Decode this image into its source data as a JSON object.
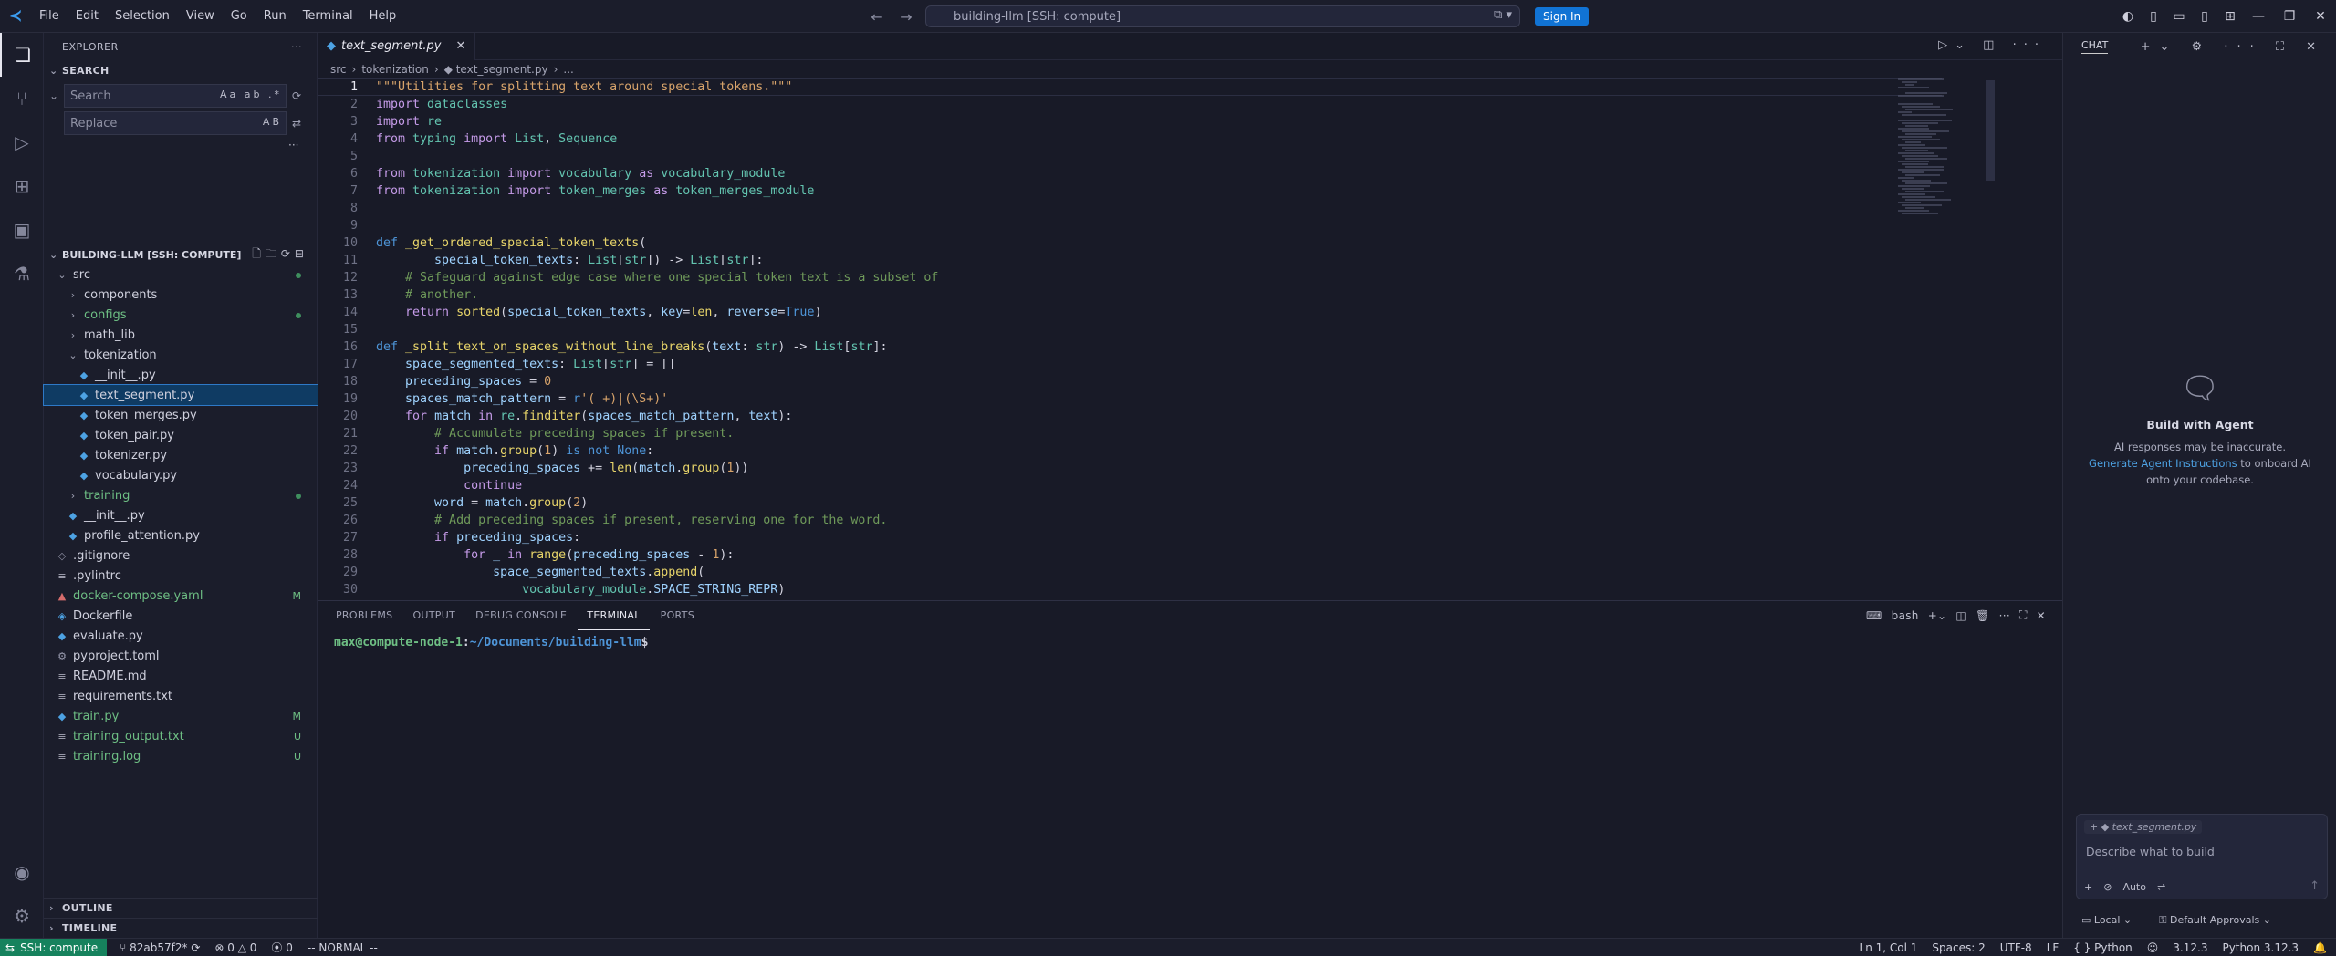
{
  "menu": [
    "File",
    "Edit",
    "Selection",
    "View",
    "Go",
    "Run",
    "Terminal",
    "Help"
  ],
  "command_center": {
    "text": "building-llm [SSH: compute]",
    "signin": "Sign In"
  },
  "sidebar": {
    "title": "EXPLORER",
    "search_section": "SEARCH",
    "search_placeholder": "Search",
    "search_opts": "Aa ab .*",
    "replace_placeholder": "Replace",
    "replace_opts": "AB",
    "workspace": "BUILDING-LLM [SSH: COMPUTE]",
    "tree": [
      {
        "name": "src",
        "type": "folder-open",
        "indent": 0,
        "dot": true
      },
      {
        "name": "components",
        "type": "folder",
        "indent": 1
      },
      {
        "name": "configs",
        "type": "folder",
        "indent": 1,
        "dot": true,
        "green": true
      },
      {
        "name": "math_lib",
        "type": "folder",
        "indent": 1
      },
      {
        "name": "tokenization",
        "type": "folder-open",
        "indent": 1
      },
      {
        "name": "__init__.py",
        "type": "py",
        "indent": 2
      },
      {
        "name": "text_segment.py",
        "type": "py",
        "indent": 2,
        "selected": true
      },
      {
        "name": "token_merges.py",
        "type": "py",
        "indent": 2
      },
      {
        "name": "token_pair.py",
        "type": "py",
        "indent": 2
      },
      {
        "name": "tokenizer.py",
        "type": "py",
        "indent": 2
      },
      {
        "name": "vocabulary.py",
        "type": "py",
        "indent": 2
      },
      {
        "name": "training",
        "type": "folder",
        "indent": 1,
        "dot": true,
        "green": true
      },
      {
        "name": "__init__.py",
        "type": "py",
        "indent": 1
      },
      {
        "name": "profile_attention.py",
        "type": "py",
        "indent": 1
      },
      {
        "name": ".gitignore",
        "type": "git",
        "indent": 0
      },
      {
        "name": ".pylintrc",
        "type": "txt",
        "indent": 0
      },
      {
        "name": "docker-compose.yaml",
        "type": "yaml",
        "indent": 0,
        "badge": "M",
        "green": true
      },
      {
        "name": "Dockerfile",
        "type": "docker",
        "indent": 0
      },
      {
        "name": "evaluate.py",
        "type": "py",
        "indent": 0
      },
      {
        "name": "pyproject.toml",
        "type": "toml",
        "indent": 0
      },
      {
        "name": "README.md",
        "type": "txt",
        "indent": 0
      },
      {
        "name": "requirements.txt",
        "type": "txt",
        "indent": 0
      },
      {
        "name": "train.py",
        "type": "py",
        "indent": 0,
        "badge": "M",
        "green": true
      },
      {
        "name": "training_output.txt",
        "type": "txt",
        "indent": 0,
        "badge": "U",
        "green": true
      },
      {
        "name": "training.log",
        "type": "txt",
        "indent": 0,
        "badge": "U",
        "green": true
      }
    ],
    "outline": "OUTLINE",
    "timeline": "TIMELINE"
  },
  "editor": {
    "tab": "text_segment.py",
    "breadcrumb": [
      "src",
      "tokenization",
      "text_segment.py",
      "..."
    ],
    "lines": [
      [
        [
          "s",
          "\"\"\"Utilities for splitting text around special tokens.\"\"\""
        ]
      ],
      [
        [
          "kw",
          "import "
        ],
        [
          "t",
          "dataclasses"
        ]
      ],
      [
        [
          "kw",
          "import "
        ],
        [
          "t",
          "re"
        ]
      ],
      [
        [
          "kw",
          "from "
        ],
        [
          "t",
          "typing "
        ],
        [
          "kw",
          "import "
        ],
        [
          "t",
          "List"
        ],
        [
          "p",
          ", "
        ],
        [
          "t",
          "Sequence"
        ]
      ],
      [],
      [
        [
          "kw",
          "from "
        ],
        [
          "t",
          "tokenization "
        ],
        [
          "kw",
          "import "
        ],
        [
          "t",
          "vocabulary "
        ],
        [
          "kw",
          "as "
        ],
        [
          "t",
          "vocabulary_module"
        ]
      ],
      [
        [
          "kw",
          "from "
        ],
        [
          "t",
          "tokenization "
        ],
        [
          "kw",
          "import "
        ],
        [
          "t",
          "token_merges "
        ],
        [
          "kw",
          "as "
        ],
        [
          "t",
          "token_merges_module"
        ]
      ],
      [],
      [],
      [
        [
          "b",
          "def "
        ],
        [
          "f",
          "_get_ordered_special_token_texts"
        ],
        [
          "p",
          "("
        ]
      ],
      [
        [
          "p",
          "        "
        ],
        [
          "n",
          "special_token_texts"
        ],
        [
          "p",
          ": "
        ],
        [
          "t",
          "List"
        ],
        [
          "p",
          "["
        ],
        [
          "t",
          "str"
        ],
        [
          "p",
          "]) -> "
        ],
        [
          "t",
          "List"
        ],
        [
          "p",
          "["
        ],
        [
          "t",
          "str"
        ],
        [
          "p",
          "]:"
        ]
      ],
      [
        [
          "p",
          "    "
        ],
        [
          "c",
          "# Safeguard against edge case where one special token text is a subset of"
        ]
      ],
      [
        [
          "p",
          "    "
        ],
        [
          "c",
          "# another."
        ]
      ],
      [
        [
          "p",
          "    "
        ],
        [
          "kw",
          "return "
        ],
        [
          "f",
          "sorted"
        ],
        [
          "p",
          "("
        ],
        [
          "n",
          "special_token_texts"
        ],
        [
          "p",
          ", "
        ],
        [
          "n",
          "key"
        ],
        [
          "p",
          "="
        ],
        [
          "f",
          "len"
        ],
        [
          "p",
          ", "
        ],
        [
          "n",
          "reverse"
        ],
        [
          "p",
          "="
        ],
        [
          "b",
          "True"
        ],
        [
          "p",
          ")"
        ]
      ],
      [],
      [
        [
          "b",
          "def "
        ],
        [
          "f",
          "_split_text_on_spaces_without_line_breaks"
        ],
        [
          "p",
          "("
        ],
        [
          "n",
          "text"
        ],
        [
          "p",
          ": "
        ],
        [
          "t",
          "str"
        ],
        [
          "p",
          ") -> "
        ],
        [
          "t",
          "List"
        ],
        [
          "p",
          "["
        ],
        [
          "t",
          "str"
        ],
        [
          "p",
          "]:"
        ]
      ],
      [
        [
          "p",
          "    "
        ],
        [
          "n",
          "space_segmented_texts"
        ],
        [
          "p",
          ": "
        ],
        [
          "t",
          "List"
        ],
        [
          "p",
          "["
        ],
        [
          "t",
          "str"
        ],
        [
          "p",
          "] = []"
        ]
      ],
      [
        [
          "p",
          "    "
        ],
        [
          "n",
          "preceding_spaces"
        ],
        [
          "p",
          " = "
        ],
        [
          "s",
          "0"
        ]
      ],
      [
        [
          "p",
          "    "
        ],
        [
          "n",
          "spaces_match_pattern"
        ],
        [
          "p",
          " = "
        ],
        [
          "b",
          "r"
        ],
        [
          "s",
          "'( +)|(\\S+)'"
        ]
      ],
      [
        [
          "p",
          "    "
        ],
        [
          "kw",
          "for "
        ],
        [
          "n",
          "match "
        ],
        [
          "kw",
          "in "
        ],
        [
          "t",
          "re"
        ],
        [
          "p",
          "."
        ],
        [
          "f",
          "finditer"
        ],
        [
          "p",
          "("
        ],
        [
          "n",
          "spaces_match_pattern"
        ],
        [
          "p",
          ", "
        ],
        [
          "n",
          "text"
        ],
        [
          "p",
          "):"
        ]
      ],
      [
        [
          "p",
          "        "
        ],
        [
          "c",
          "# Accumulate preceding spaces if present."
        ]
      ],
      [
        [
          "p",
          "        "
        ],
        [
          "kw",
          "if "
        ],
        [
          "n",
          "match"
        ],
        [
          "p",
          "."
        ],
        [
          "f",
          "group"
        ],
        [
          "p",
          "("
        ],
        [
          "s",
          "1"
        ],
        [
          "p",
          ") "
        ],
        [
          "b",
          "is not "
        ],
        [
          "b",
          "None"
        ],
        [
          "p",
          ":"
        ]
      ],
      [
        [
          "p",
          "            "
        ],
        [
          "n",
          "preceding_spaces"
        ],
        [
          "p",
          " += "
        ],
        [
          "f",
          "len"
        ],
        [
          "p",
          "("
        ],
        [
          "n",
          "match"
        ],
        [
          "p",
          "."
        ],
        [
          "f",
          "group"
        ],
        [
          "p",
          "("
        ],
        [
          "s",
          "1"
        ],
        [
          "p",
          "))"
        ]
      ],
      [
        [
          "p",
          "            "
        ],
        [
          "kw",
          "continue"
        ]
      ],
      [
        [
          "p",
          "        "
        ],
        [
          "n",
          "word"
        ],
        [
          "p",
          " = "
        ],
        [
          "n",
          "match"
        ],
        [
          "p",
          "."
        ],
        [
          "f",
          "group"
        ],
        [
          "p",
          "("
        ],
        [
          "s",
          "2"
        ],
        [
          "p",
          ")"
        ]
      ],
      [
        [
          "p",
          "        "
        ],
        [
          "c",
          "# Add preceding spaces if present, reserving one for the word."
        ]
      ],
      [
        [
          "p",
          "        "
        ],
        [
          "kw",
          "if "
        ],
        [
          "n",
          "preceding_spaces"
        ],
        [
          "p",
          ":"
        ]
      ],
      [
        [
          "p",
          "            "
        ],
        [
          "kw",
          "for "
        ],
        [
          "n",
          "_ "
        ],
        [
          "kw",
          "in "
        ],
        [
          "f",
          "range"
        ],
        [
          "p",
          "("
        ],
        [
          "n",
          "preceding_spaces"
        ],
        [
          "p",
          " - "
        ],
        [
          "s",
          "1"
        ],
        [
          "p",
          "):"
        ]
      ],
      [
        [
          "p",
          "                "
        ],
        [
          "n",
          "space_segmented_texts"
        ],
        [
          "p",
          "."
        ],
        [
          "f",
          "append"
        ],
        [
          "p",
          "("
        ]
      ],
      [
        [
          "p",
          "                    "
        ],
        [
          "t",
          "vocabulary_module"
        ],
        [
          "p",
          "."
        ],
        [
          "n",
          "SPACE_STRING_REPR"
        ],
        [
          "p",
          ")"
        ]
      ]
    ]
  },
  "panel": {
    "tabs": [
      "PROBLEMS",
      "OUTPUT",
      "DEBUG CONSOLE",
      "TERMINAL",
      "PORTS"
    ],
    "active": "TERMINAL",
    "shell": "bash",
    "prompt_user": "max@compute-node-1",
    "prompt_path": "~/Documents/building-llm",
    "prompt_suffix": "$"
  },
  "chat": {
    "title": "CHAT",
    "heading": "Build with Agent",
    "note": "AI responses may be inaccurate.",
    "link": "Generate Agent Instructions",
    "note2": " to onboard AI onto your codebase.",
    "file": "text_segment.py",
    "placeholder": "Describe what to build",
    "mode": "Auto",
    "local": "Local",
    "approvals": "Default Approvals"
  },
  "status": {
    "remote": "SSH: compute",
    "branch": "82ab57f2*",
    "errors": "0",
    "warnings": "0",
    "ports": "0",
    "mode": "-- NORMAL --",
    "position": "Ln 1, Col 1",
    "spaces": "Spaces: 2",
    "encoding": "UTF-8",
    "eol": "LF",
    "language": "{ } Python",
    "py_ver": "3.12.3",
    "interp": "Python 3.12.3"
  }
}
